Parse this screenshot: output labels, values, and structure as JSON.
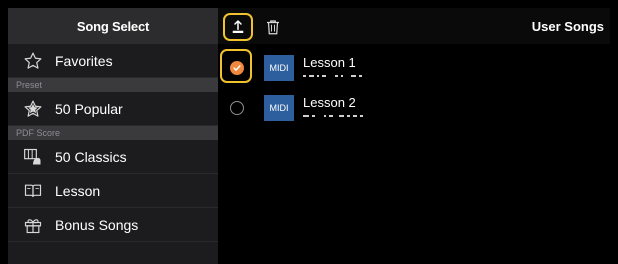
{
  "sidebar": {
    "title": "Song Select",
    "items": [
      {
        "label": "Favorites",
        "icon": "star-outline-icon"
      },
      {
        "label": "50 Popular",
        "icon": "star-burst-icon"
      },
      {
        "label": "50 Classics",
        "icon": "piano-hand-icon"
      },
      {
        "label": "Lesson",
        "icon": "book-icon"
      },
      {
        "label": "Bonus Songs",
        "icon": "gift-icon"
      }
    ],
    "sections": [
      "Preset",
      "PDF Score"
    ]
  },
  "toolbar": {
    "title": "User Songs",
    "upload_icon": "upload-icon",
    "delete_icon": "trash-icon"
  },
  "songs": [
    {
      "name": "Lesson 1",
      "badge": "MIDI",
      "checked": true
    },
    {
      "name": "Lesson 2",
      "badge": "MIDI",
      "checked": false
    }
  ],
  "colors": {
    "highlight": "#f2c12e",
    "check": "#f0883e",
    "midi": "#2d5f9e"
  }
}
